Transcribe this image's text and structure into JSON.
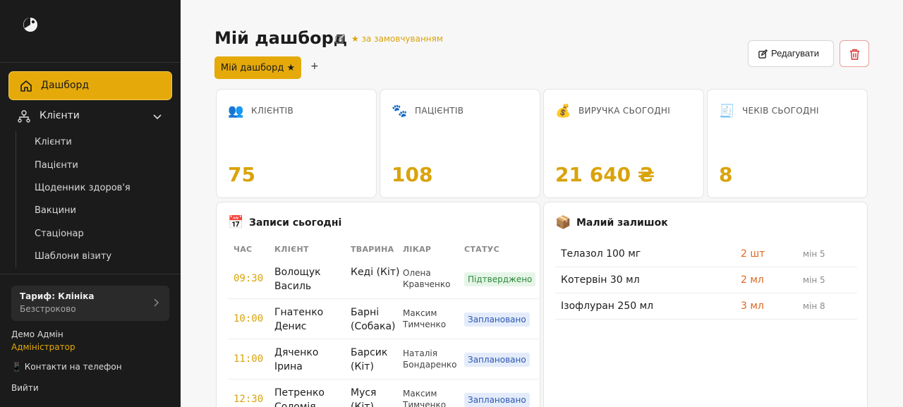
{
  "sidebar": {
    "active_item": "Дашборд",
    "group_label": "Клієнти",
    "sub_items": [
      "Клієнти",
      "Пацієнти",
      "Щоденник здоров'я",
      "Вакцини",
      "Стаціонар",
      "Шаблони візиту"
    ],
    "plan_title": "Тариф: Клініка",
    "plan_sub": "Безстроково",
    "user_name": "Демо Адмін",
    "user_role": "Адміністратор",
    "contacts": "📱 Контакти на телефон",
    "logout": "Вийти"
  },
  "header": {
    "title": "Мій дашборд",
    "default_badge": "★ за замовчуванням",
    "tab_label": "Мій дашборд ★",
    "add_tab": "+",
    "edit_label": "Редагувати"
  },
  "stats": [
    {
      "icon": "👥",
      "label": "КЛІЄНТІВ",
      "value": "75"
    },
    {
      "icon": "🐾",
      "label": "ПАЦІЄНТІВ",
      "value": "108"
    },
    {
      "icon": "💰",
      "label": "ВИРУЧКА СЬОГОДНІ",
      "value": "21 640 ₴"
    },
    {
      "icon": "🧾",
      "label": "ЧЕКІВ СЬОГОДНІ",
      "value": "8"
    }
  ],
  "appointments": {
    "icon": "📅",
    "title": "Записи сьогодні",
    "columns": [
      "ЧАС",
      "КЛІЄНТ",
      "ТВАРИНА",
      "ЛІКАР",
      "СТАТУС"
    ],
    "rows": [
      {
        "time": "09:30",
        "client": "Волощук Василь",
        "pet": "Кеді (Кіт)",
        "doctor": "Олена Кравченко",
        "status": "Підтверджено"
      },
      {
        "time": "10:00",
        "client": "Гнатенко Денис",
        "pet": "Барні (Собака)",
        "doctor": "Максим Тимченко",
        "status": "Заплановано"
      },
      {
        "time": "11:00",
        "client": "Дяченко Ірина",
        "pet": "Барсик (Кіт)",
        "doctor": "Наталія Бондаренко",
        "status": "Заплановано"
      },
      {
        "time": "12:30",
        "client": "Петренко Соломія",
        "pet": "Муся (Кіт)",
        "doctor": "Максим Тимченко",
        "status": "Заплановано"
      }
    ]
  },
  "low_stock": {
    "icon": "📦",
    "title": "Малий залишок",
    "items": [
      {
        "name": "Телазол 100 мг",
        "qty": "2 шт",
        "min": "мін 5"
      },
      {
        "name": "Котервін 30 мл",
        "qty": "2 мл",
        "min": "мін 5"
      },
      {
        "name": "Ізофлуран 250 мл",
        "qty": "3 мл",
        "min": "мін 8"
      }
    ]
  },
  "colors": {
    "accent": "#e5aa0a",
    "sidebar_bg": "#1b1b1b",
    "danger": "#e0661f"
  }
}
